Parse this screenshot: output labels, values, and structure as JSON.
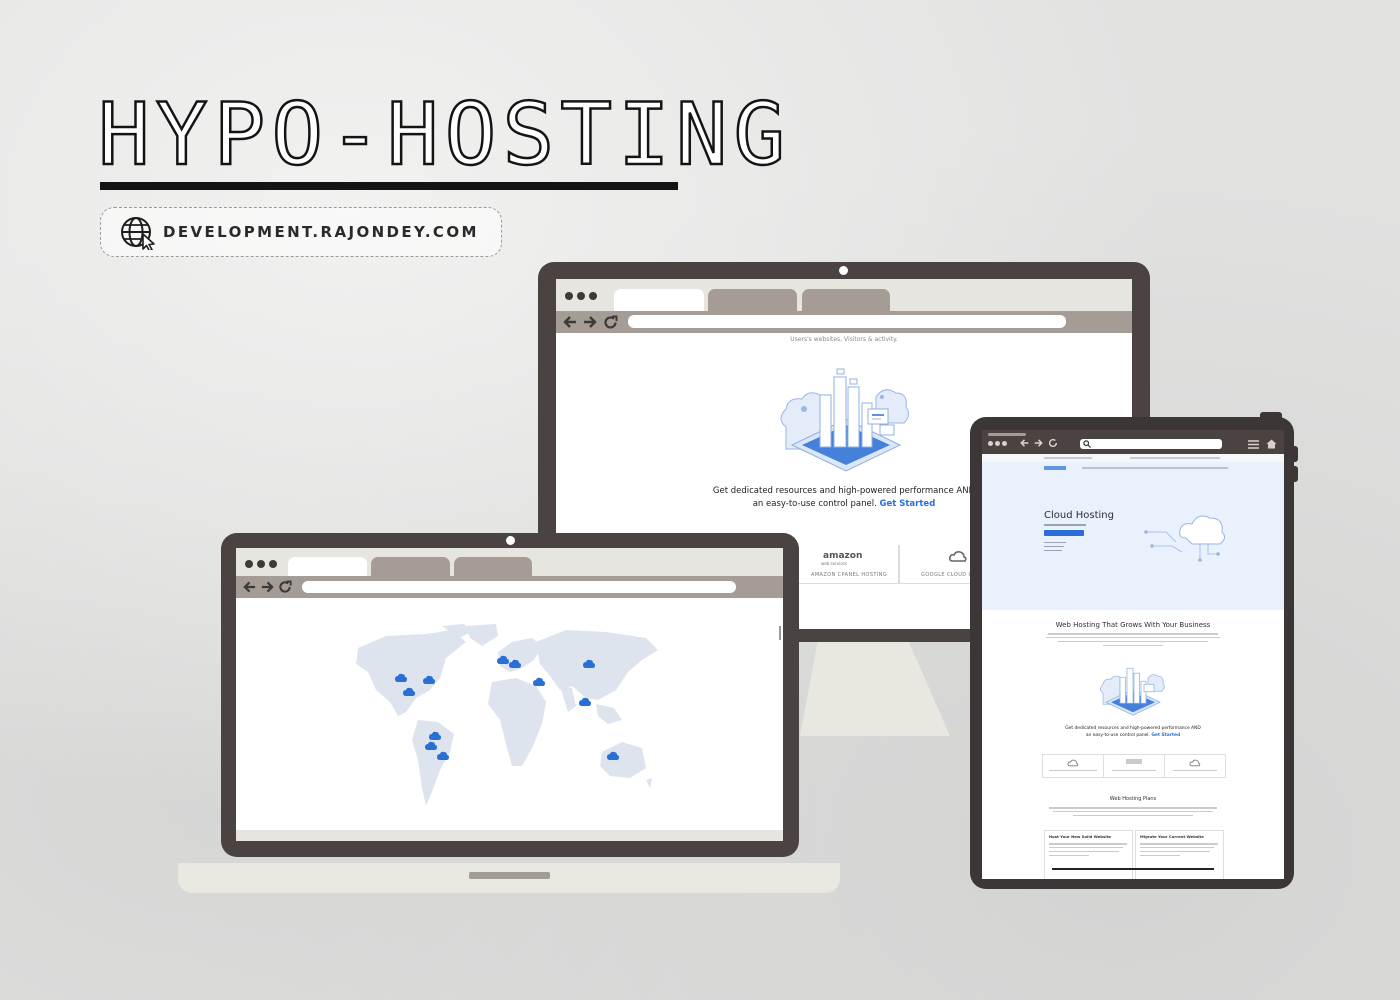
{
  "brand": {
    "title": "HYPO-HOSTING",
    "url": "DEVELOPMENT.RAJONDEY.COM",
    "globe_icon": "globe-cursor-icon"
  },
  "colors": {
    "frame": "#4b4242",
    "chrome_tab_inactive": "#a59d95",
    "chrome_bg": "#e6e5df",
    "accent": "#2a6fd6",
    "map_land": "#dde4ed"
  },
  "monitor": {
    "faded_text": "Users's websites, Visitors & activity.",
    "caption": "Get dedicated resources and high-powered performance AND an easy-to-use control panel.",
    "cta": "Get Started",
    "partners": [
      {
        "logo": "amazon",
        "logo_sub": "web services",
        "caption": "AMAZON CPANEL HOSTING"
      },
      {
        "logo": "google-cloud-icon",
        "caption": "GOOGLE CLOUD CPANEL"
      }
    ]
  },
  "tablet": {
    "hero_title": "Cloud Hosting",
    "section_title": "Web Hosting That Grows With Your Business",
    "caption": "Get dedicated resources and high-powered performance AND an easy-to-use control panel.",
    "cta": "Get Started",
    "plans_title": "Web Hosting Plans",
    "plans": [
      {
        "title": "Host Your New Solid Website"
      },
      {
        "title": "Migrate Your Current Website"
      }
    ]
  }
}
